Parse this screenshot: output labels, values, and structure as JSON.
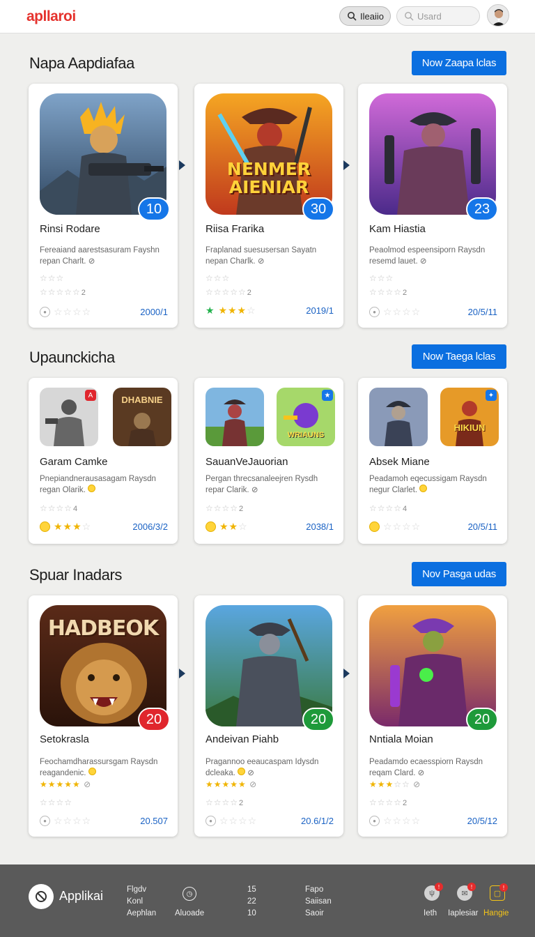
{
  "header": {
    "logo": "apllaroi",
    "pill_button_label": "Ileaiio",
    "search_placeholder": "Usard"
  },
  "sections": [
    {
      "title": "Napa Aapdiafaa",
      "button": "Now Zaapa lclas",
      "cards": [
        {
          "title": "Rinsi Rodare",
          "desc_line1": "Fereaiand aarestsasuram Fayshn",
          "desc_line2": "repan Charlt.",
          "stars_label": "2",
          "year": "2000/1",
          "badge": "10"
        },
        {
          "title": "Riisa Frarika",
          "desc_line1": "Fraplanad suesusersan Sayatn",
          "desc_line2": "nepan Charlk.",
          "stars_label": "2",
          "year": "2019/1",
          "badge": "30",
          "art_text_line1": "NENMER",
          "art_text_line2": "AIENIAR"
        },
        {
          "title": "Kam Hiastia",
          "desc_line1": "Peaolmod espeensiporn Raysdn",
          "desc_line2": "resemd lauet.",
          "stars_label": "2",
          "year": "20/5/11",
          "badge": "23"
        }
      ]
    },
    {
      "title": "Upaunckicha",
      "button": "Now Taega lclas",
      "cards": [
        {
          "title": "Garam Camke",
          "desc_line1": "Pnepiandnerausasagam Raysdn",
          "desc_line2": "regan Olarik.",
          "stars_label": "4",
          "year": "2006/3/2",
          "thumb2_text": "DHABNIE"
        },
        {
          "title": "SauanVeJauorian",
          "desc_line1": "Pergan threcsanaleejren Rysdh",
          "desc_line2": "repar Clarik.",
          "stars_label": "2",
          "year": "2038/1",
          "thumb2_text": "WRIAUNS"
        },
        {
          "title": "Absek Miane",
          "desc_line1": "Peadamoh eqecussigam Raysdn",
          "desc_line2": "negur Clarlet.",
          "stars_label": "4",
          "year": "20/5/11",
          "thumb2_text": "HIKIUN"
        }
      ]
    },
    {
      "title": "Spuar Inadars",
      "button": "Nov Pasga udas",
      "cards": [
        {
          "title": "Setokrasla",
          "desc_line1": "Feochamdharassursgam Raysdn",
          "desc_line2": "reagandenic.",
          "stars_label": "",
          "year": "20.507",
          "badge": "20",
          "art_text_line1": "HADBEOK"
        },
        {
          "title": "Andeivan Piahb",
          "desc_line1": "Pragannoo eeaucaspam Idysdn",
          "desc_line2": "dcleaka.",
          "stars_label": "2",
          "year": "20.6/1/2",
          "badge": "20"
        },
        {
          "title": "Nntiala Moian",
          "desc_line1": "Peadamdo ecaesspiorn Raysdn",
          "desc_line2": "reqam Clard.",
          "stars_label": "2",
          "year": "20/5/12",
          "badge": "20"
        }
      ]
    }
  ],
  "footer": {
    "brand": "Applikai",
    "col1": [
      "Flgdv",
      "Konl",
      "Aephlan"
    ],
    "mid_label": "Aluoade",
    "col2": [
      "15",
      "22",
      "10"
    ],
    "col3": [
      "Fapo",
      "Saiisan",
      "Saoir"
    ],
    "icon1_label": "Ieth",
    "icon2_label": "Iaplesiar",
    "icon3_label": "Hangie",
    "accent_yellow": "#f5c518",
    "accent_blue": "#0b6fe0",
    "accent_red": "#e5322d"
  }
}
